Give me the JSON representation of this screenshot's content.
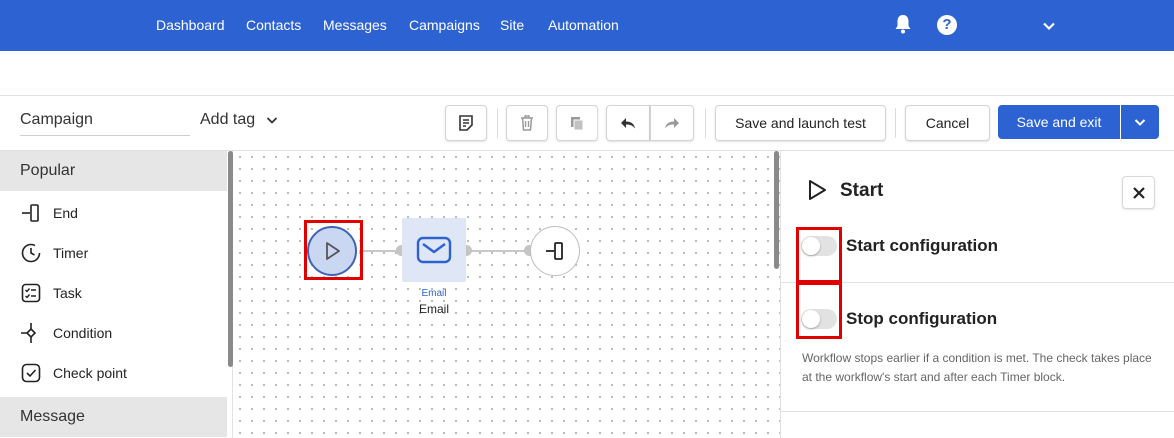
{
  "nav": {
    "items": [
      "Dashboard",
      "Contacts",
      "Messages",
      "Campaigns",
      "Site",
      "Automation"
    ],
    "icons": {
      "notifications": "bell-icon",
      "help": "help-icon",
      "account_menu": "chevron-down-icon"
    },
    "help_glyph": "?"
  },
  "toolbar": {
    "campaign_name": "Campaign",
    "add_tag_label": "Add tag",
    "save_launch_test_label": "Save and launch test",
    "cancel_label": "Cancel",
    "save_exit_label": "Save and exit"
  },
  "palette": {
    "sections": [
      {
        "title": "Popular",
        "items": [
          {
            "label": "End",
            "icon": "end-icon"
          },
          {
            "label": "Timer",
            "icon": "timer-icon"
          },
          {
            "label": "Task",
            "icon": "task-icon"
          },
          {
            "label": "Condition",
            "icon": "condition-icon"
          },
          {
            "label": "Check point",
            "icon": "check-point-icon"
          }
        ]
      },
      {
        "title": "Message",
        "items": []
      }
    ]
  },
  "canvas": {
    "nodes": [
      {
        "type": "start",
        "icon": "play-icon",
        "highlighted": true
      },
      {
        "type": "email",
        "icon": "email-icon",
        "tag": "Email",
        "label": "Email"
      },
      {
        "type": "end",
        "icon": "end-icon"
      }
    ]
  },
  "panel": {
    "title": "Start",
    "start_configuration_label": "Start configuration",
    "start_configuration_enabled": false,
    "stop_configuration_label": "Stop configuration",
    "stop_configuration_enabled": false,
    "stop_description": "Workflow stops earlier if a condition is met. The check takes place at the workflow's start and after each Timer block."
  },
  "colors": {
    "brand_blue": "#2d62d2",
    "highlight_red": "#e00000",
    "start_node_fill": "#c9d7f2",
    "email_node_fill": "#dfe7f7"
  }
}
